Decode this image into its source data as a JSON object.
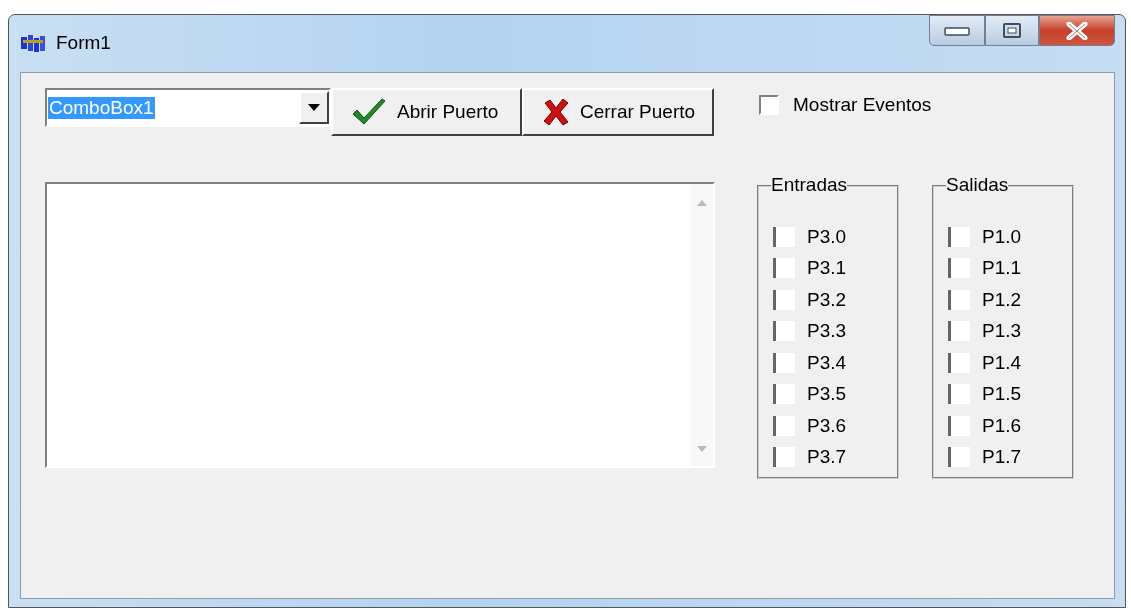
{
  "window": {
    "title": "Form1"
  },
  "combo": {
    "value": "ComboBox1"
  },
  "buttons": [
    {
      "kind": "open",
      "label": "Abrir Puerto"
    },
    {
      "kind": "close",
      "label": "Cerrar Puerto"
    }
  ],
  "show_events": {
    "label": "Mostrar Eventos",
    "checked": false
  },
  "groups": [
    {
      "title": "Entradas",
      "pins": [
        {
          "label": "P3.0",
          "checked": false
        },
        {
          "label": "P3.1",
          "checked": false
        },
        {
          "label": "P3.2",
          "checked": false
        },
        {
          "label": "P3.3",
          "checked": false
        },
        {
          "label": "P3.4",
          "checked": false
        },
        {
          "label": "P3.5",
          "checked": false
        },
        {
          "label": "P3.6",
          "checked": false
        },
        {
          "label": "P3.7",
          "checked": false
        }
      ]
    },
    {
      "title": "Salidas",
      "pins": [
        {
          "label": "P1.0",
          "checked": false
        },
        {
          "label": "P1.1",
          "checked": false
        },
        {
          "label": "P1.2",
          "checked": false
        },
        {
          "label": "P1.3",
          "checked": false
        },
        {
          "label": "P1.4",
          "checked": false
        },
        {
          "label": "P1.5",
          "checked": false
        },
        {
          "label": "P1.6",
          "checked": false
        },
        {
          "label": "P1.7",
          "checked": false
        }
      ]
    }
  ]
}
